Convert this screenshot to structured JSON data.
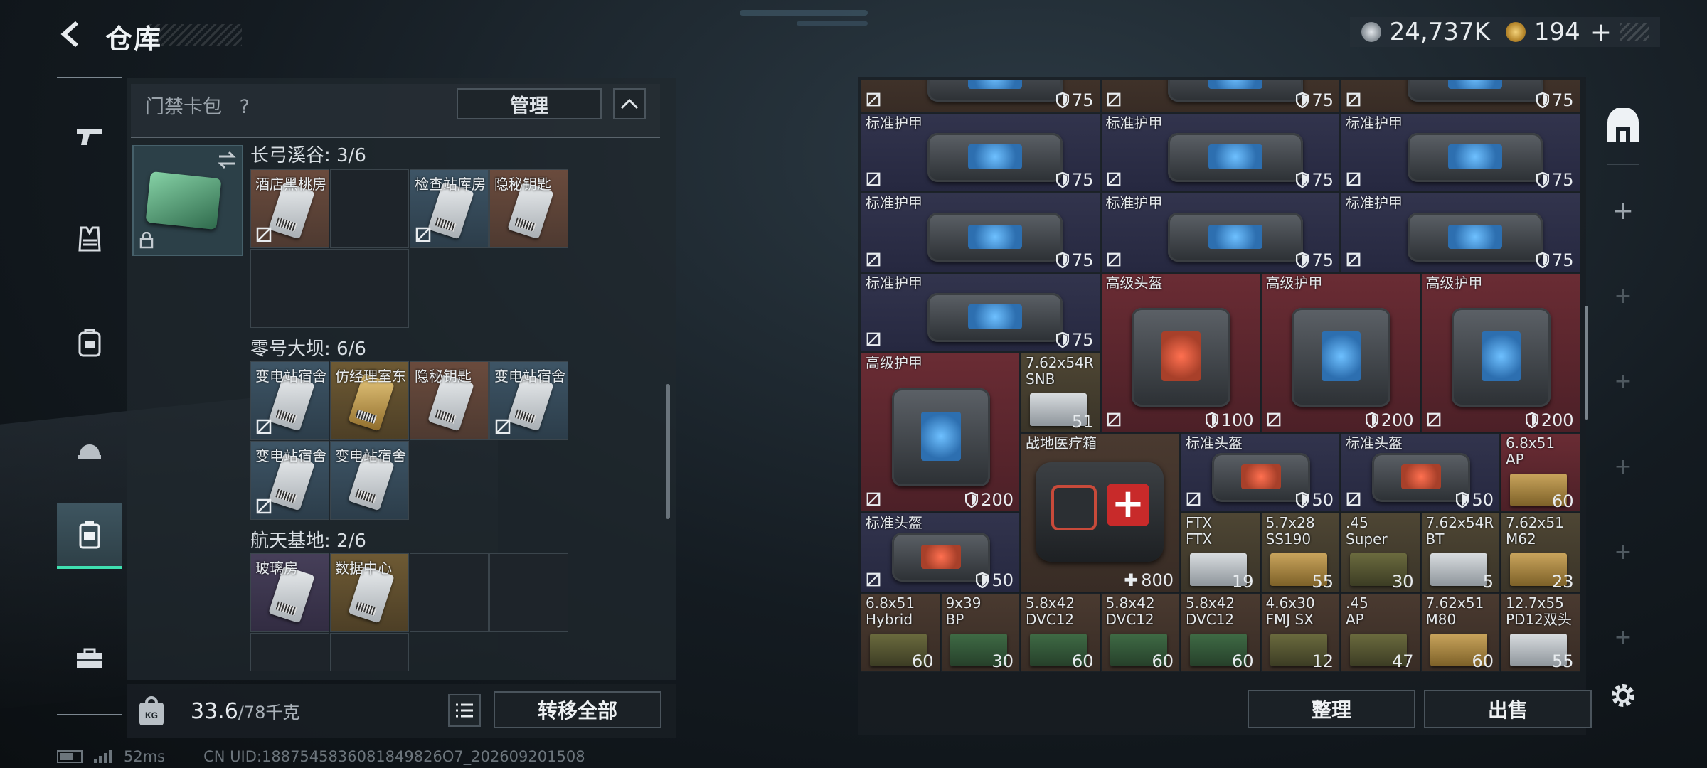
{
  "header": {
    "title": "仓库",
    "currency1": "24,737K",
    "currency2": "194"
  },
  "left_panel": {
    "title": "门禁卡包",
    "help": "?",
    "manage_label": "管理",
    "sections": [
      {
        "title": "长弓溪谷: 3/6",
        "cards": [
          "酒店黑桃房",
          "",
          "检查站库房",
          "隐秘钥匙"
        ]
      },
      {
        "title": "零号大坝: 6/6",
        "cards": [
          "变电站宿舍",
          "仿经理室东",
          "隐秘钥匙",
          "变电站宿舍",
          "变电站宿舍",
          "变电站宿舍"
        ]
      },
      {
        "title": "航天基地: 2/6",
        "cards": [
          "玻璃房",
          "数据中心"
        ]
      }
    ],
    "weight_current": "33.6",
    "weight_max": "/78千克",
    "transfer_label": "转移全部"
  },
  "status": {
    "ping": "52ms",
    "uid": "CN UID:1887545836081849826O7_202609201508"
  },
  "inventory": {
    "items": [
      {
        "name": "",
        "value": "75"
      },
      {
        "name": "",
        "value": "75"
      },
      {
        "name": "",
        "value": "75"
      },
      {
        "name": "标准护甲",
        "value": "75"
      },
      {
        "name": "标准护甲",
        "value": "75"
      },
      {
        "name": "标准护甲",
        "value": "75"
      },
      {
        "name": "标准护甲",
        "value": "75"
      },
      {
        "name": "标准护甲",
        "value": "75"
      },
      {
        "name": "标准护甲",
        "value": "75"
      },
      {
        "name": "标准护甲",
        "value": "75"
      },
      {
        "name": "高级头盔",
        "value": "100"
      },
      {
        "name": "高级护甲",
        "value": "200"
      },
      {
        "name": "高级护甲",
        "value": "200"
      },
      {
        "name": "高级护甲",
        "value": "200"
      },
      {
        "name": "7.62x54R\nSNB",
        "value": "51"
      },
      {
        "name": "战地医疗箱",
        "value": "800"
      },
      {
        "name": "标准头盔",
        "value": "50"
      },
      {
        "name": "标准头盔",
        "value": "50"
      },
      {
        "name": "6.8x51\nAP",
        "value": "60"
      },
      {
        "name": "标准头盔",
        "value": "50"
      },
      {
        "name": "FTX\nFTX",
        "value": "19"
      },
      {
        "name": "5.7x28\nSS190",
        "value": "55"
      },
      {
        "name": ".45\nSuper",
        "value": "30"
      },
      {
        "name": "7.62x54R\nBT",
        "value": "5"
      },
      {
        "name": "7.62x51\nM62",
        "value": "23"
      },
      {
        "name": "6.8x51\nHybrid",
        "value": "60"
      },
      {
        "name": "9x39\nBP",
        "value": "30"
      },
      {
        "name": "5.8x42\nDVC12",
        "value": "60"
      },
      {
        "name": "5.8x42\nDVC12",
        "value": "60"
      },
      {
        "name": "5.8x42\nDVC12",
        "value": "60"
      },
      {
        "name": "4.6x30\nFMJ SX",
        "value": "12"
      },
      {
        "name": ".45\nAP",
        "value": "47"
      },
      {
        "name": "7.62x51\nM80",
        "value": "60"
      },
      {
        "name": "12.7x55\nPD12双头",
        "value": "55"
      }
    ]
  },
  "buttons": {
    "sort": "整理",
    "sell": "出售"
  }
}
